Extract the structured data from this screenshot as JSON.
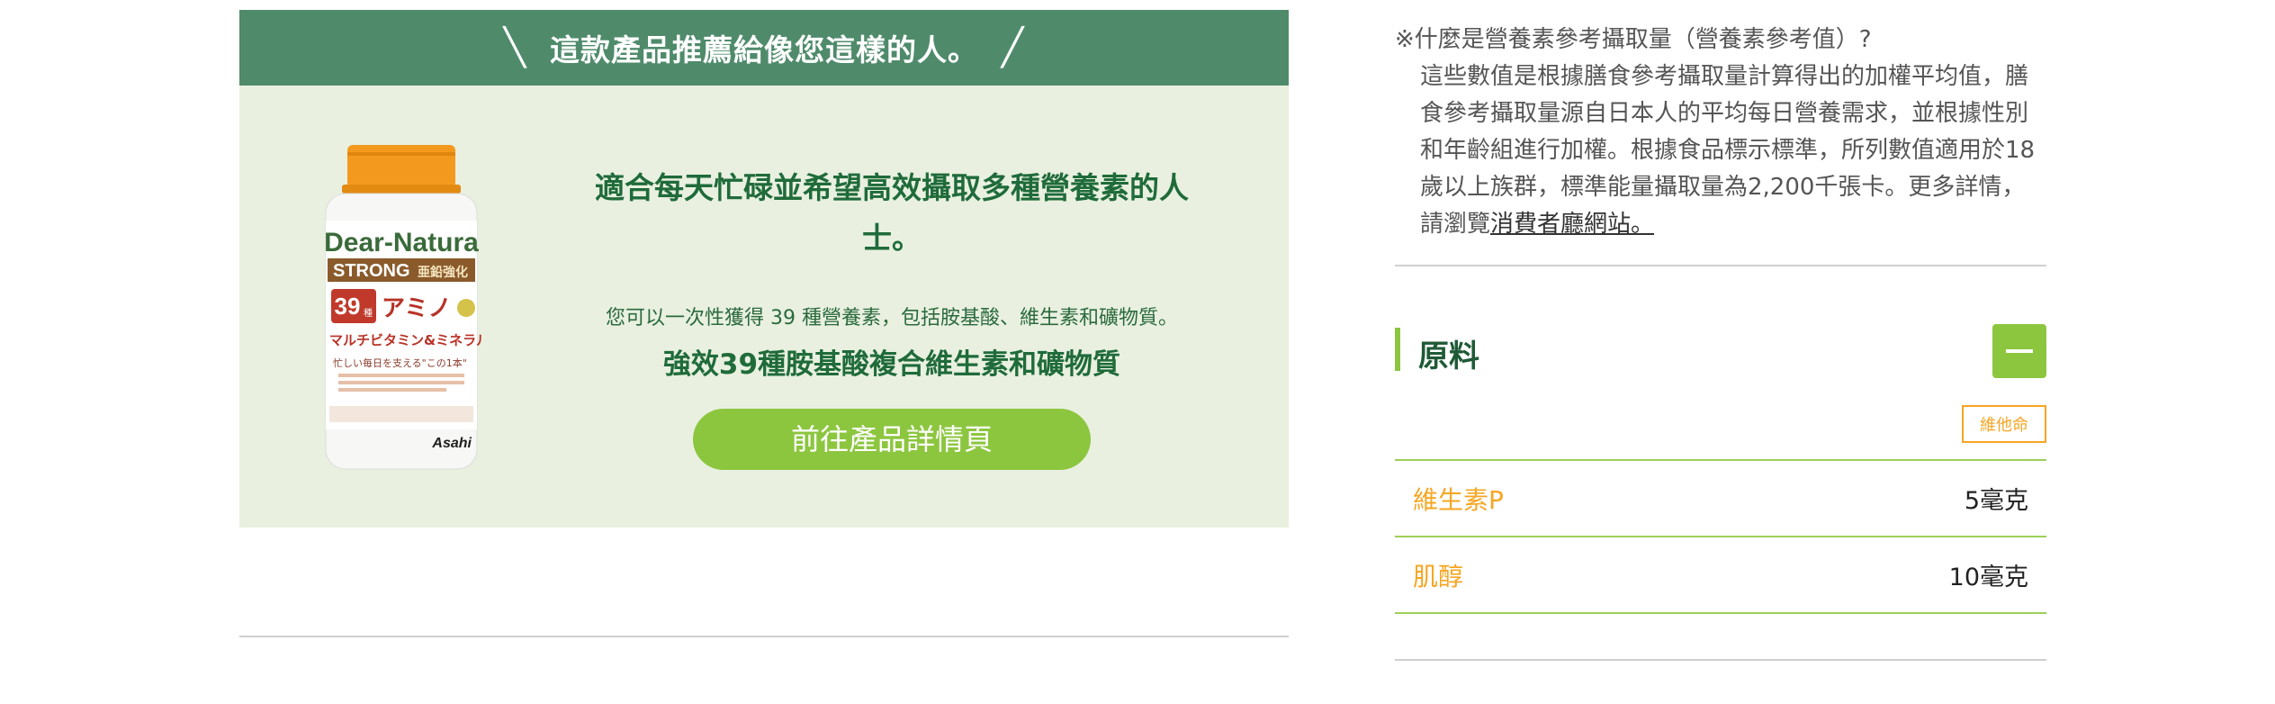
{
  "recommend": {
    "header": "這款產品推薦給像您這樣的人。",
    "slash_left": "╲",
    "slash_right": "╱",
    "title": "適合每天忙碌並希望高效攝取多種營養素的人士。",
    "description": "您可以一次性獲得 39 種營養素，包括胺基酸、維生素和礦物質。",
    "subtitle": "強效39種胺基酸複合維生素和礦物質",
    "button_label": "前往產品詳情頁",
    "product": {
      "brand": "Dear-Natura",
      "line": "STRONG",
      "line_sub": "亜鉛強化",
      "count_badge": "39",
      "count_unit": "種",
      "name_jp_1": "アミノ",
      "name_jp_2": "マルチビタミン&ミネラル",
      "tagline": "忙しい毎日を支える\"この1本\"",
      "maker": "Asahi"
    }
  },
  "note": {
    "question": "※什麼是營養素參考攝取量（營養素參考值）?",
    "body": "這些數值是根據膳食參考攝取量計算得出的加權平均值，膳食參考攝取量源自日本人的平均每日營養需求，並根據性別和年齡組進行加權。根據食品標示標準，所列數值適用於18歲以上族群，標準能量攝取量為2,200千張卡。更多詳情，請瀏覽",
    "link_text": "消費者廳網站。"
  },
  "ingredients": {
    "title": "原料",
    "tag": "維他命",
    "rows": [
      {
        "name": "維生素P",
        "value": "5毫克"
      },
      {
        "name": "肌醇",
        "value": "10毫克"
      }
    ]
  },
  "colors": {
    "header_green": "#4f8b6b",
    "card_bg": "#e9f0e0",
    "accent_green": "#8cc63f",
    "text_green": "#1f6b3a",
    "orange": "#f5a623"
  },
  "icons": {
    "toggle": "minus-icon"
  }
}
